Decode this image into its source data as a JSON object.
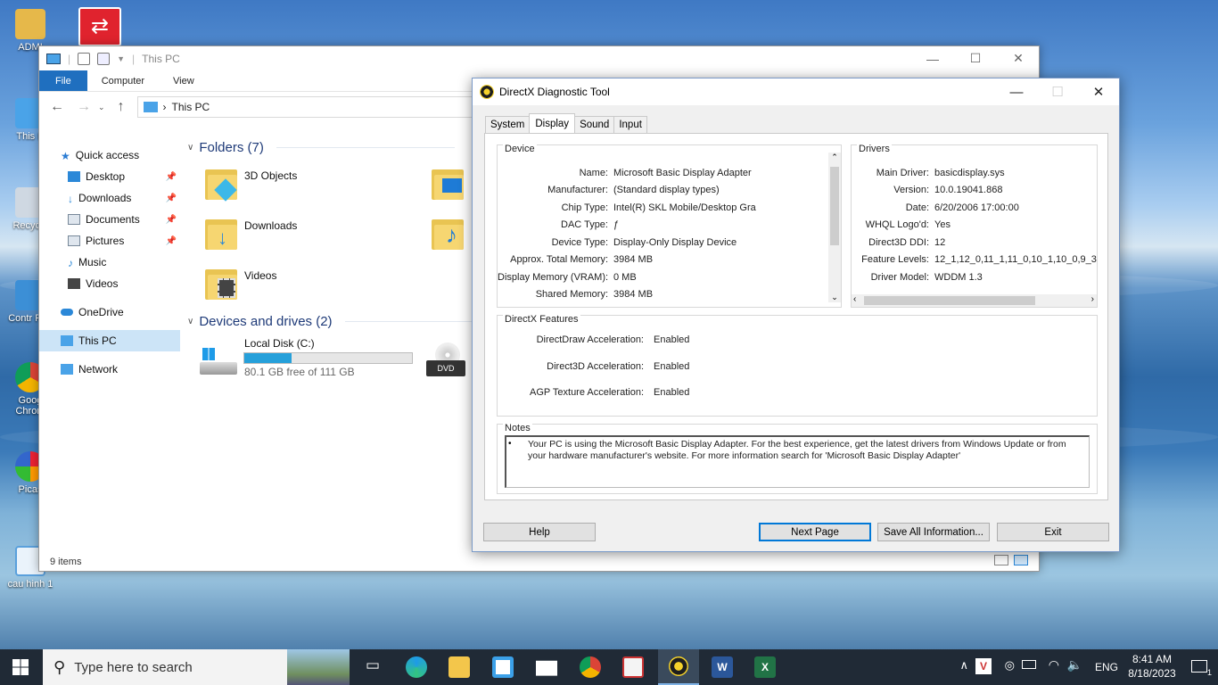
{
  "desktop": {
    "icons": [
      {
        "label": "ADMI",
        "icon": "user-folder-icon"
      },
      {
        "label": "",
        "icon": "switch-app-icon"
      },
      {
        "label": "This P",
        "icon": "this-pc-icon"
      },
      {
        "label": "Recycle",
        "icon": "recycle-bin-icon"
      },
      {
        "label": "Contr Pan",
        "icon": "control-panel-icon"
      },
      {
        "label": "Goog Chrom",
        "icon": "chrome-icon"
      },
      {
        "label": "Picas",
        "icon": "picasa-icon"
      },
      {
        "label": "cau hinh 1",
        "icon": "screenshot-file-icon"
      }
    ]
  },
  "explorer": {
    "title": "This PC",
    "ribbon": {
      "file": "File",
      "computer": "Computer",
      "view": "View"
    },
    "address": "This PC",
    "nav": [
      {
        "label": "Quick access",
        "pinned": false
      },
      {
        "label": "Desktop",
        "pinned": true
      },
      {
        "label": "Downloads",
        "pinned": true
      },
      {
        "label": "Documents",
        "pinned": true
      },
      {
        "label": "Pictures",
        "pinned": true
      },
      {
        "label": "Music",
        "pinned": false
      },
      {
        "label": "Videos",
        "pinned": false
      },
      {
        "label": "OneDrive",
        "pinned": false
      },
      {
        "label": "This PC",
        "pinned": false
      },
      {
        "label": "Network",
        "pinned": false
      }
    ],
    "folders_header": "Folders (7)",
    "folders": [
      "3D Objects",
      "Downloads",
      "Videos"
    ],
    "devices_header": "Devices and drives (2)",
    "drive": {
      "name": "Local Disk (C:)",
      "free": "80.1 GB free of 111 GB",
      "used_fraction": 0.28
    },
    "dvd_label": "DVD",
    "status": "9 items"
  },
  "dxdiag": {
    "title": "DirectX Diagnostic Tool",
    "tabs": [
      "System",
      "Display",
      "Sound",
      "Input"
    ],
    "active_tab": "Display",
    "device_title": "Device",
    "device": [
      {
        "k": "Name:",
        "v": "Microsoft Basic Display Adapter"
      },
      {
        "k": "Manufacturer:",
        "v": "(Standard display types)"
      },
      {
        "k": "Chip Type:",
        "v": "Intel(R) SKL Mobile/Desktop Gra"
      },
      {
        "k": "DAC Type:",
        "v": "ƒ"
      },
      {
        "k": "Device Type:",
        "v": "Display-Only Display Device"
      },
      {
        "k": "Approx. Total Memory:",
        "v": "3984 MB"
      },
      {
        "k": "Display Memory (VRAM):",
        "v": "0 MB"
      },
      {
        "k": "Shared Memory:",
        "v": "3984 MB"
      }
    ],
    "drivers_title": "Drivers",
    "drivers": [
      {
        "k": "Main Driver:",
        "v": "basicdisplay.sys"
      },
      {
        "k": "Version:",
        "v": "10.0.19041.868"
      },
      {
        "k": "Date:",
        "v": "6/20/2006 17:00:00"
      },
      {
        "k": "WHQL Logo'd:",
        "v": "Yes"
      },
      {
        "k": "Direct3D DDI:",
        "v": "12"
      },
      {
        "k": "Feature Levels:",
        "v": "12_1,12_0,11_1,11_0,10_1,10_0,9_3"
      },
      {
        "k": "Driver Model:",
        "v": "WDDM 1.3"
      }
    ],
    "features_title": "DirectX Features",
    "features": [
      {
        "k": "DirectDraw Acceleration:",
        "v": "Enabled"
      },
      {
        "k": "Direct3D Acceleration:",
        "v": "Enabled"
      },
      {
        "k": "AGP Texture Acceleration:",
        "v": "Enabled"
      }
    ],
    "notes_title": "Notes",
    "notes_line1": "Your PC is using the Microsoft Basic Display Adapter. For the best experience, get the latest drivers from Windows Update or from",
    "notes_line2": "your hardware manufacturer's website. For more information search for 'Microsoft Basic Display Adapter'",
    "buttons": {
      "help": "Help",
      "next": "Next Page",
      "save": "Save All Information...",
      "exit": "Exit"
    }
  },
  "taskbar": {
    "search_placeholder": "Type here to search",
    "lang": "ENG",
    "time": "8:41 AM",
    "date": "8/18/2023",
    "notif_count": "1"
  }
}
